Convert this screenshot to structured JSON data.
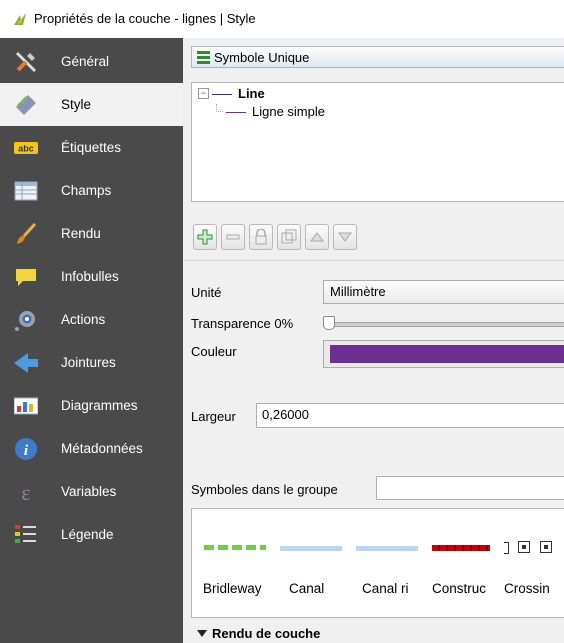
{
  "window": {
    "title": "Propriétés de la couche - lignes | Style",
    "icon": "qgis-icon"
  },
  "sidebar": {
    "items": [
      {
        "label": "Général",
        "icon": "general-tools-icon",
        "active": false
      },
      {
        "label": "Style",
        "icon": "style-brush-icon",
        "active": true
      },
      {
        "label": "Étiquettes",
        "icon": "labels-abc-icon",
        "active": false
      },
      {
        "label": "Champs",
        "icon": "fields-table-icon",
        "active": false
      },
      {
        "label": "Rendu",
        "icon": "rendering-brush-icon",
        "active": false
      },
      {
        "label": "Infobulles",
        "icon": "tooltip-bubble-icon",
        "active": false
      },
      {
        "label": "Actions",
        "icon": "actions-gear-icon",
        "active": false
      },
      {
        "label": "Jointures",
        "icon": "joins-arrow-icon",
        "active": false
      },
      {
        "label": "Diagrammes",
        "icon": "diagrams-icon",
        "active": false
      },
      {
        "label": "Métadonnées",
        "icon": "info-icon",
        "active": false
      },
      {
        "label": "Variables",
        "icon": "variables-epsilon-icon",
        "active": false
      },
      {
        "label": "Légende",
        "icon": "legend-icon",
        "active": false
      }
    ]
  },
  "style_panel": {
    "renderer": "Symbole Unique",
    "tree": {
      "root": "Line",
      "child": "Ligne simple"
    },
    "form": {
      "unit_label": "Unité",
      "unit_value": "Millimètre",
      "transparency_label": "Transparence 0%",
      "transparency_value": 0,
      "color_label": "Couleur",
      "color_value": "#6b2f8f",
      "width_label": "Largeur",
      "width_value": "0,26000"
    },
    "group_label": "Symboles dans le groupe",
    "group_value": "",
    "symbols": [
      "Bridleway",
      "Canal",
      "Canal ri",
      "Construc",
      "Crossin"
    ],
    "layer_render_label": "Rendu de couche"
  },
  "colors": {
    "sidebar_bg": "#4a4a4a",
    "sidebar_active": "#f2f2f2",
    "stroke_purple": "#6b2f8f",
    "bridleway_green": "#7ac943",
    "canal_blue": "#b8d7f5",
    "construction_red": "#c8000a"
  }
}
